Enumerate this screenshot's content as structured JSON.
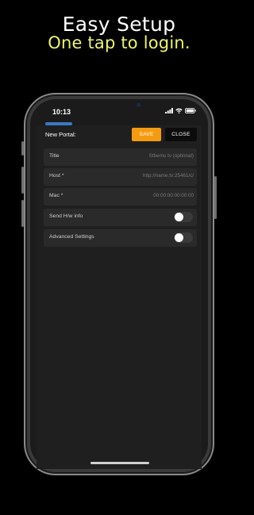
{
  "headline": {
    "main": "Easy Setup",
    "sub": "One tap to login.",
    "sub_color": "#eef56b"
  },
  "status_bar": {
    "time": "10:13",
    "icons": [
      "signal-icon",
      "wifi-icon",
      "battery-icon"
    ]
  },
  "form": {
    "title": "New Portal:",
    "save_label": "SAVE",
    "close_label": "CLOSE",
    "accent_color": "#f59b12",
    "fields": [
      {
        "label": "Title",
        "placeholder": "Stbemu tv (optional)"
      },
      {
        "label": "Host *",
        "placeholder": "http://name.tv:25461/c/"
      },
      {
        "label": "Mac *",
        "value": "00:00:00:00:00:00"
      }
    ],
    "toggles": [
      {
        "label": "Send H/w info",
        "on": false
      },
      {
        "label": "Advanced Settings",
        "on": false
      }
    ]
  }
}
